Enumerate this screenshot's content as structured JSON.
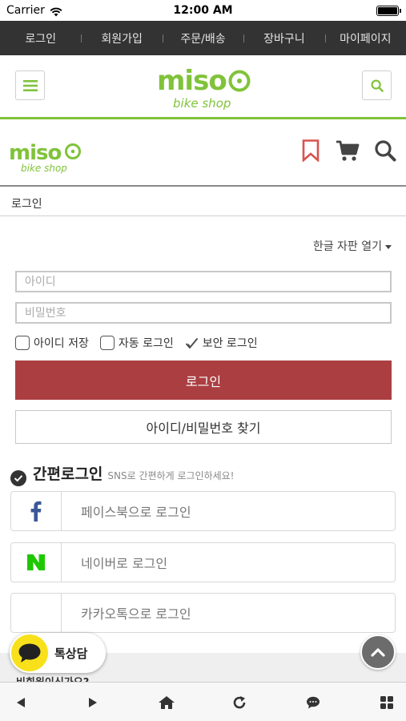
{
  "status_bar": {
    "carrier": "Carrier",
    "time": "12:00 AM"
  },
  "top_nav": {
    "items": [
      "로그인",
      "회원가입",
      "주문/배송",
      "장바구니",
      "마이페이지"
    ]
  },
  "header": {
    "logo_text": "miso",
    "logo_subtext": "bike shop",
    "accent_color": "#80c33a"
  },
  "breadcrumb": {
    "title": "로그인"
  },
  "login_form": {
    "keyboard_toggle": "한글 자판 열기",
    "id_placeholder": "아이디",
    "password_placeholder": "비밀번호",
    "save_id_label": "아이디 저장",
    "auto_login_label": "자동 로그인",
    "secure_login_label": "보안 로그인",
    "login_button": "로그인",
    "login_button_color": "#ab3e41",
    "find_button": "아이디/비밀번호 찾기"
  },
  "sns_login": {
    "title": "간편로그인",
    "description": "SNS로 간편하게 로그인하세요!",
    "facebook_label": "페이스북으로 로그인",
    "naver_label": "네이버로 로그인",
    "kakao_label": "카카오톡으로 로그인",
    "facebook_color": "#3b5998",
    "naver_color": "#1ec800"
  },
  "guest_section": {
    "text": "비회원이신가요?"
  },
  "kakao_chat": {
    "label": "톡상담",
    "color": "#f8e11b"
  },
  "toolbar": {
    "icons": [
      "back-icon",
      "forward-icon",
      "home-icon",
      "reload-icon",
      "chat-icon",
      "grid-icon"
    ]
  }
}
